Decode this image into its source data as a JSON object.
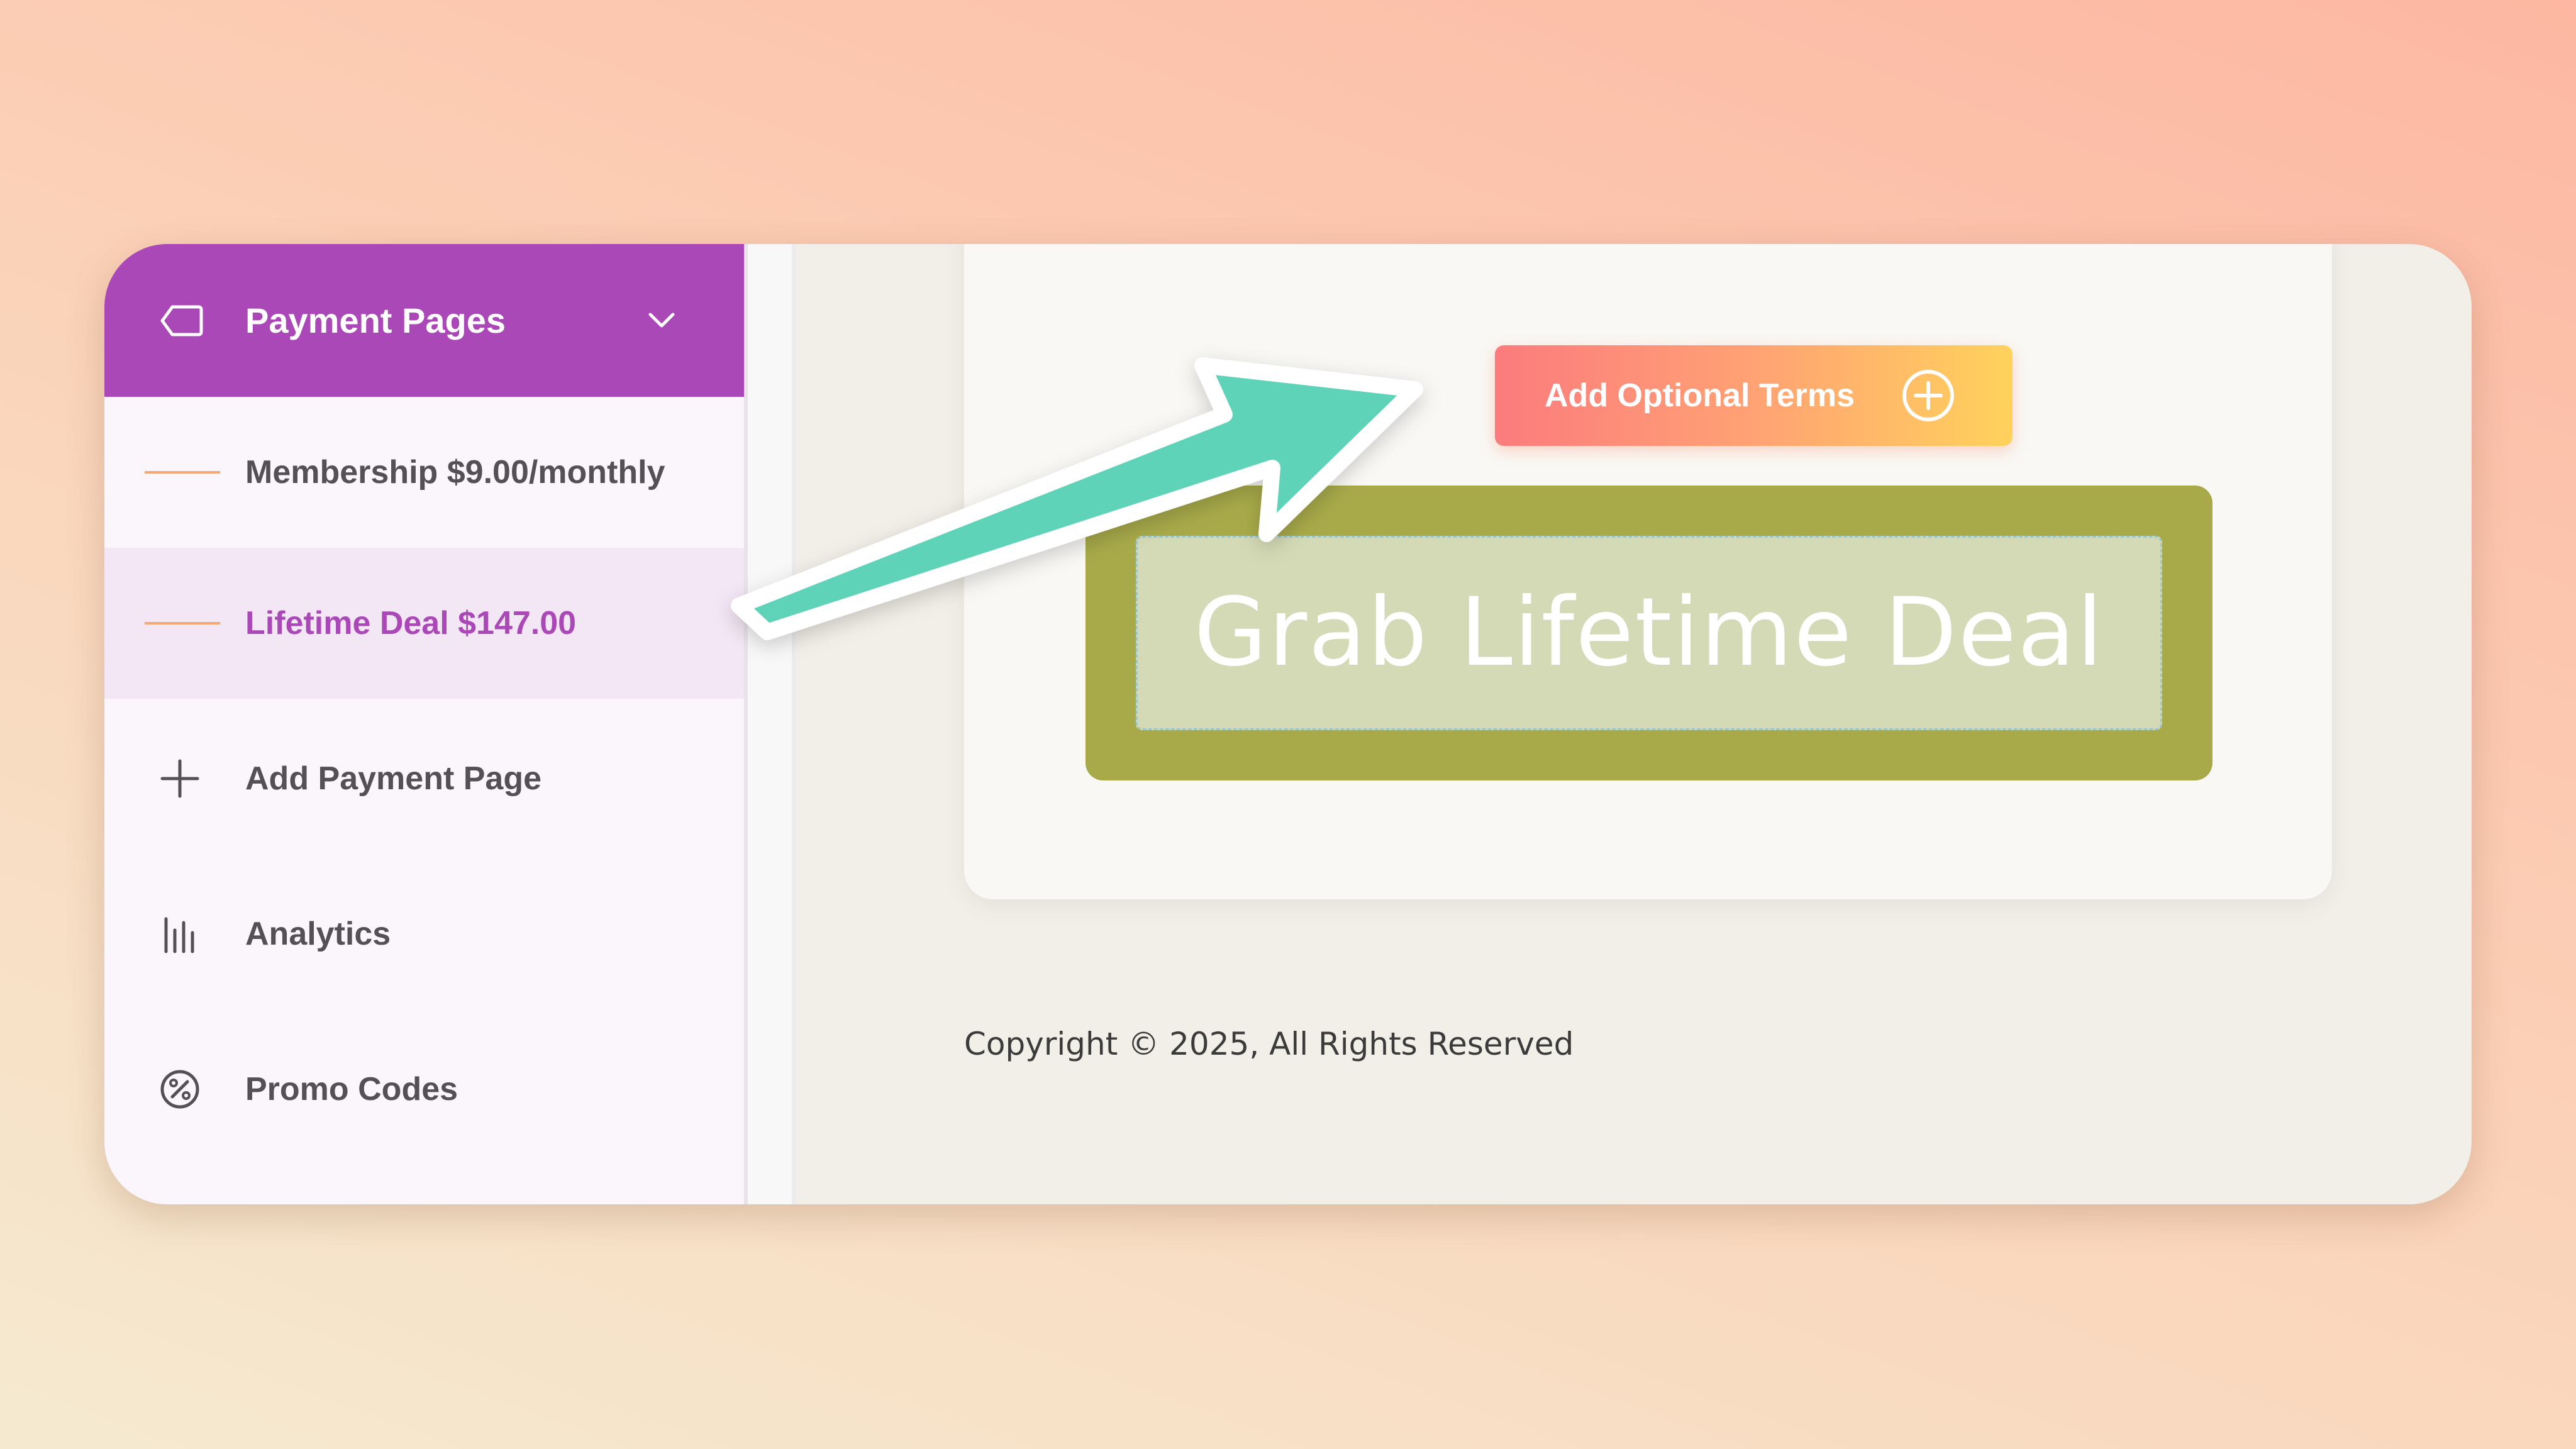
{
  "sidebar": {
    "header": {
      "label": "Payment Pages",
      "icon": "tag-icon",
      "chevron": "chevron-down-icon"
    },
    "items": [
      {
        "label": "Membership $9.00/monthly",
        "type": "sub-page",
        "active": false
      },
      {
        "label": "Lifetime Deal $147.00",
        "type": "sub-page",
        "active": true
      },
      {
        "label": "Add Payment Page",
        "icon": "plus-icon"
      },
      {
        "label": "Analytics",
        "icon": "bar-chart-icon"
      },
      {
        "label": "Promo Codes",
        "icon": "percent-icon"
      }
    ]
  },
  "main": {
    "optional_terms_label": "Add Optional Terms",
    "cta_label": "Grab Lifetime Deal",
    "copyright": "Copyright © 2025, All Rights Reserved"
  },
  "colors": {
    "brand_purple": "#ab48b8",
    "cta_olive": "#a8aa4a",
    "cta_inner": "#d5dab6",
    "arrow_teal": "#5fd3b8",
    "accent_gradient": [
      "#fb7b7d",
      "#ffa274",
      "#ffd25c"
    ]
  }
}
